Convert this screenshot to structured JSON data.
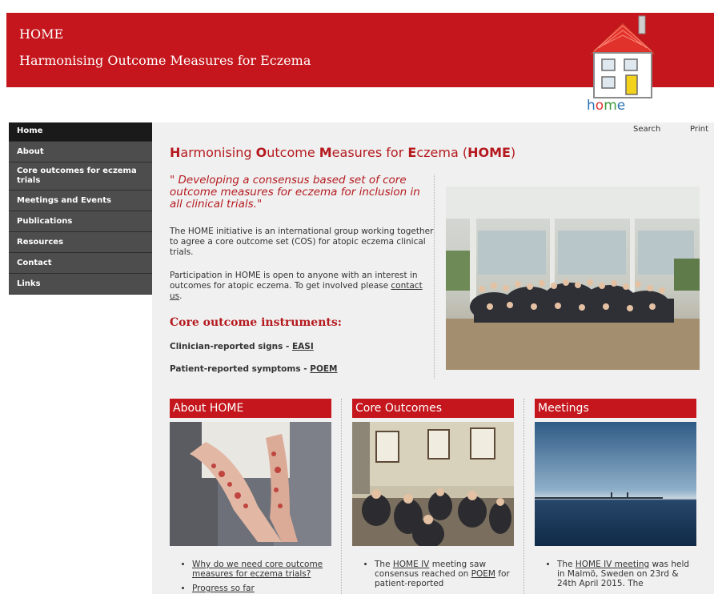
{
  "header": {
    "title": "HOME",
    "subtitle": "Harmonising Outcome Measures for Eczema",
    "logo_text": "home"
  },
  "nav": {
    "items": [
      {
        "label": "Home"
      },
      {
        "label": "About"
      },
      {
        "label": "Core outcomes for eczema trials"
      },
      {
        "label": "Meetings and Events"
      },
      {
        "label": "Publications"
      },
      {
        "label": "Resources"
      },
      {
        "label": "Contact"
      },
      {
        "label": "Links"
      }
    ]
  },
  "utility": {
    "search": "Search",
    "print": "Print"
  },
  "main": {
    "title_parts": [
      "H",
      "armonising ",
      "O",
      "utcome ",
      "M",
      "easures for ",
      "E",
      "czema (",
      "HOME",
      ")"
    ],
    "quote": "\" Developing a consensus based set of core outcome measures for  eczema for inclusion in all clinical trials.\"",
    "para1": " The HOME initiative is an international group working together to agree a core outcome set (COS) for atopic eczema clinical trials.",
    "para2_text": "Participation in HOME is open to anyone with an interest in outcomes for atopic eczema.  To get involved please ",
    "para2_link": "contact us",
    "para2_end": ".",
    "instruments_heading": "Core outcome instruments:",
    "clinician_label": "Clinician-reported signs - ",
    "clinician_link": "EASI",
    "patient_label": "Patient-reported symptoms - ",
    "patient_link": "POEM"
  },
  "boxes": [
    {
      "title": "About HOME",
      "items": [
        {
          "link": "Why do we need core outcome measures for eczema trials?",
          "pre": "",
          "post": ""
        },
        {
          "link": "Progress so far",
          "pre": "",
          "post": ""
        }
      ]
    },
    {
      "title": "Core Outcomes",
      "items": [
        {
          "pre": "The ",
          "link": "HOME IV",
          "post": " meeting saw consensus reached on ",
          "link2": "POEM",
          "post2": " for patient-reported"
        }
      ]
    },
    {
      "title": "Meetings",
      "items": [
        {
          "pre": "The ",
          "link": "HOME IV meeting",
          "post": " was held in Malmö, Sweden on 23rd & 24th April 2015. The"
        }
      ]
    }
  ],
  "colors": {
    "brand_red": "#c4161c",
    "nav_bg": "#4d4d4d",
    "nav_active": "#1a1a1a",
    "content_bg": "#f0f0f0"
  }
}
